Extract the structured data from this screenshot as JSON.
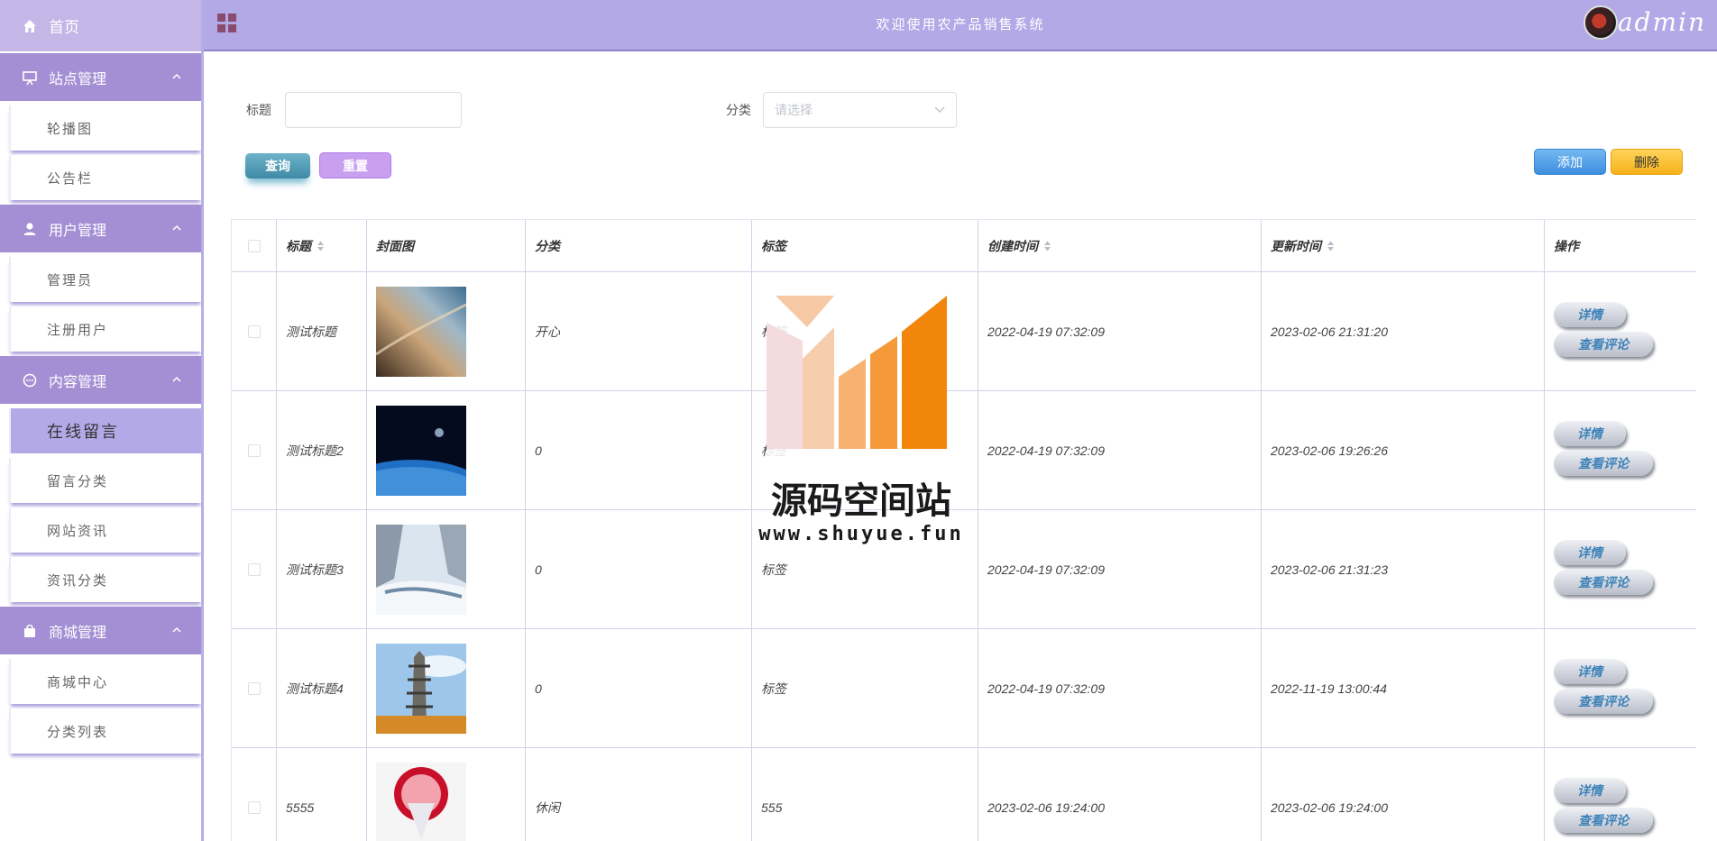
{
  "header": {
    "system_title": "欢迎使用农产品销售系统",
    "username": "admin"
  },
  "sidebar": {
    "home": "首页",
    "groups": [
      {
        "label": "站点管理",
        "icon": "presentation-board-icon",
        "items": [
          "轮播图",
          "公告栏"
        ]
      },
      {
        "label": "用户管理",
        "icon": "user-icon",
        "items": [
          "管理员",
          "注册用户"
        ]
      },
      {
        "label": "内容管理",
        "icon": "chat-bubble-icon",
        "items": [
          "在线留言",
          "留言分类",
          "网站资讯",
          "资讯分类"
        ]
      },
      {
        "label": "商城管理",
        "icon": "shopping-bag-icon",
        "items": [
          "商城中心",
          "分类列表"
        ]
      }
    ],
    "active_item": "在线留言"
  },
  "search": {
    "title_label": "标题",
    "title_value": "",
    "category_label": "分类",
    "category_placeholder": "请选择",
    "query_button": "查询",
    "reset_button": "重置",
    "add_button": "添加",
    "delete_button": "删除"
  },
  "table": {
    "columns": [
      "标题",
      "封面图",
      "分类",
      "标签",
      "创建时间",
      "更新时间",
      "操作"
    ],
    "rows": [
      {
        "title": "测试标题",
        "category": "开心",
        "tag": "标签",
        "created": "2022-04-19 07:32:09",
        "updated": "2023-02-06 21:31:20",
        "image": "sky-clouds"
      },
      {
        "title": "测试标题2",
        "category": "0",
        "tag": "标签",
        "created": "2022-04-19 07:32:09",
        "updated": "2023-02-06 19:26:26",
        "image": "earth-space"
      },
      {
        "title": "测试标题3",
        "category": "0",
        "tag": "标签",
        "created": "2022-04-19 07:32:09",
        "updated": "2023-02-06 21:31:23",
        "image": "snow-river"
      },
      {
        "title": "测试标题4",
        "category": "0",
        "tag": "标签",
        "created": "2022-04-19 07:32:09",
        "updated": "2022-11-19 13:00:44",
        "image": "pagoda"
      },
      {
        "title": "5555",
        "category": "休闲",
        "tag": "555",
        "created": "2023-02-06 19:24:00",
        "updated": "2023-02-06 19:24:00",
        "image": "rose-bouquet"
      }
    ],
    "detail_button": "详情",
    "comment_button": "查看评论"
  },
  "watermark": {
    "title": "源码空间站",
    "url": "www.shuyue.fun"
  },
  "colors": {
    "sidebar_header": "#a48ed4",
    "topbar": "#b2a9e6",
    "active_item": "#b2a9e6",
    "query_button": "#4a94ad",
    "reset_button": "#c99ff0",
    "add_button": "#4a97e6",
    "delete_button": "#f5b21a"
  }
}
